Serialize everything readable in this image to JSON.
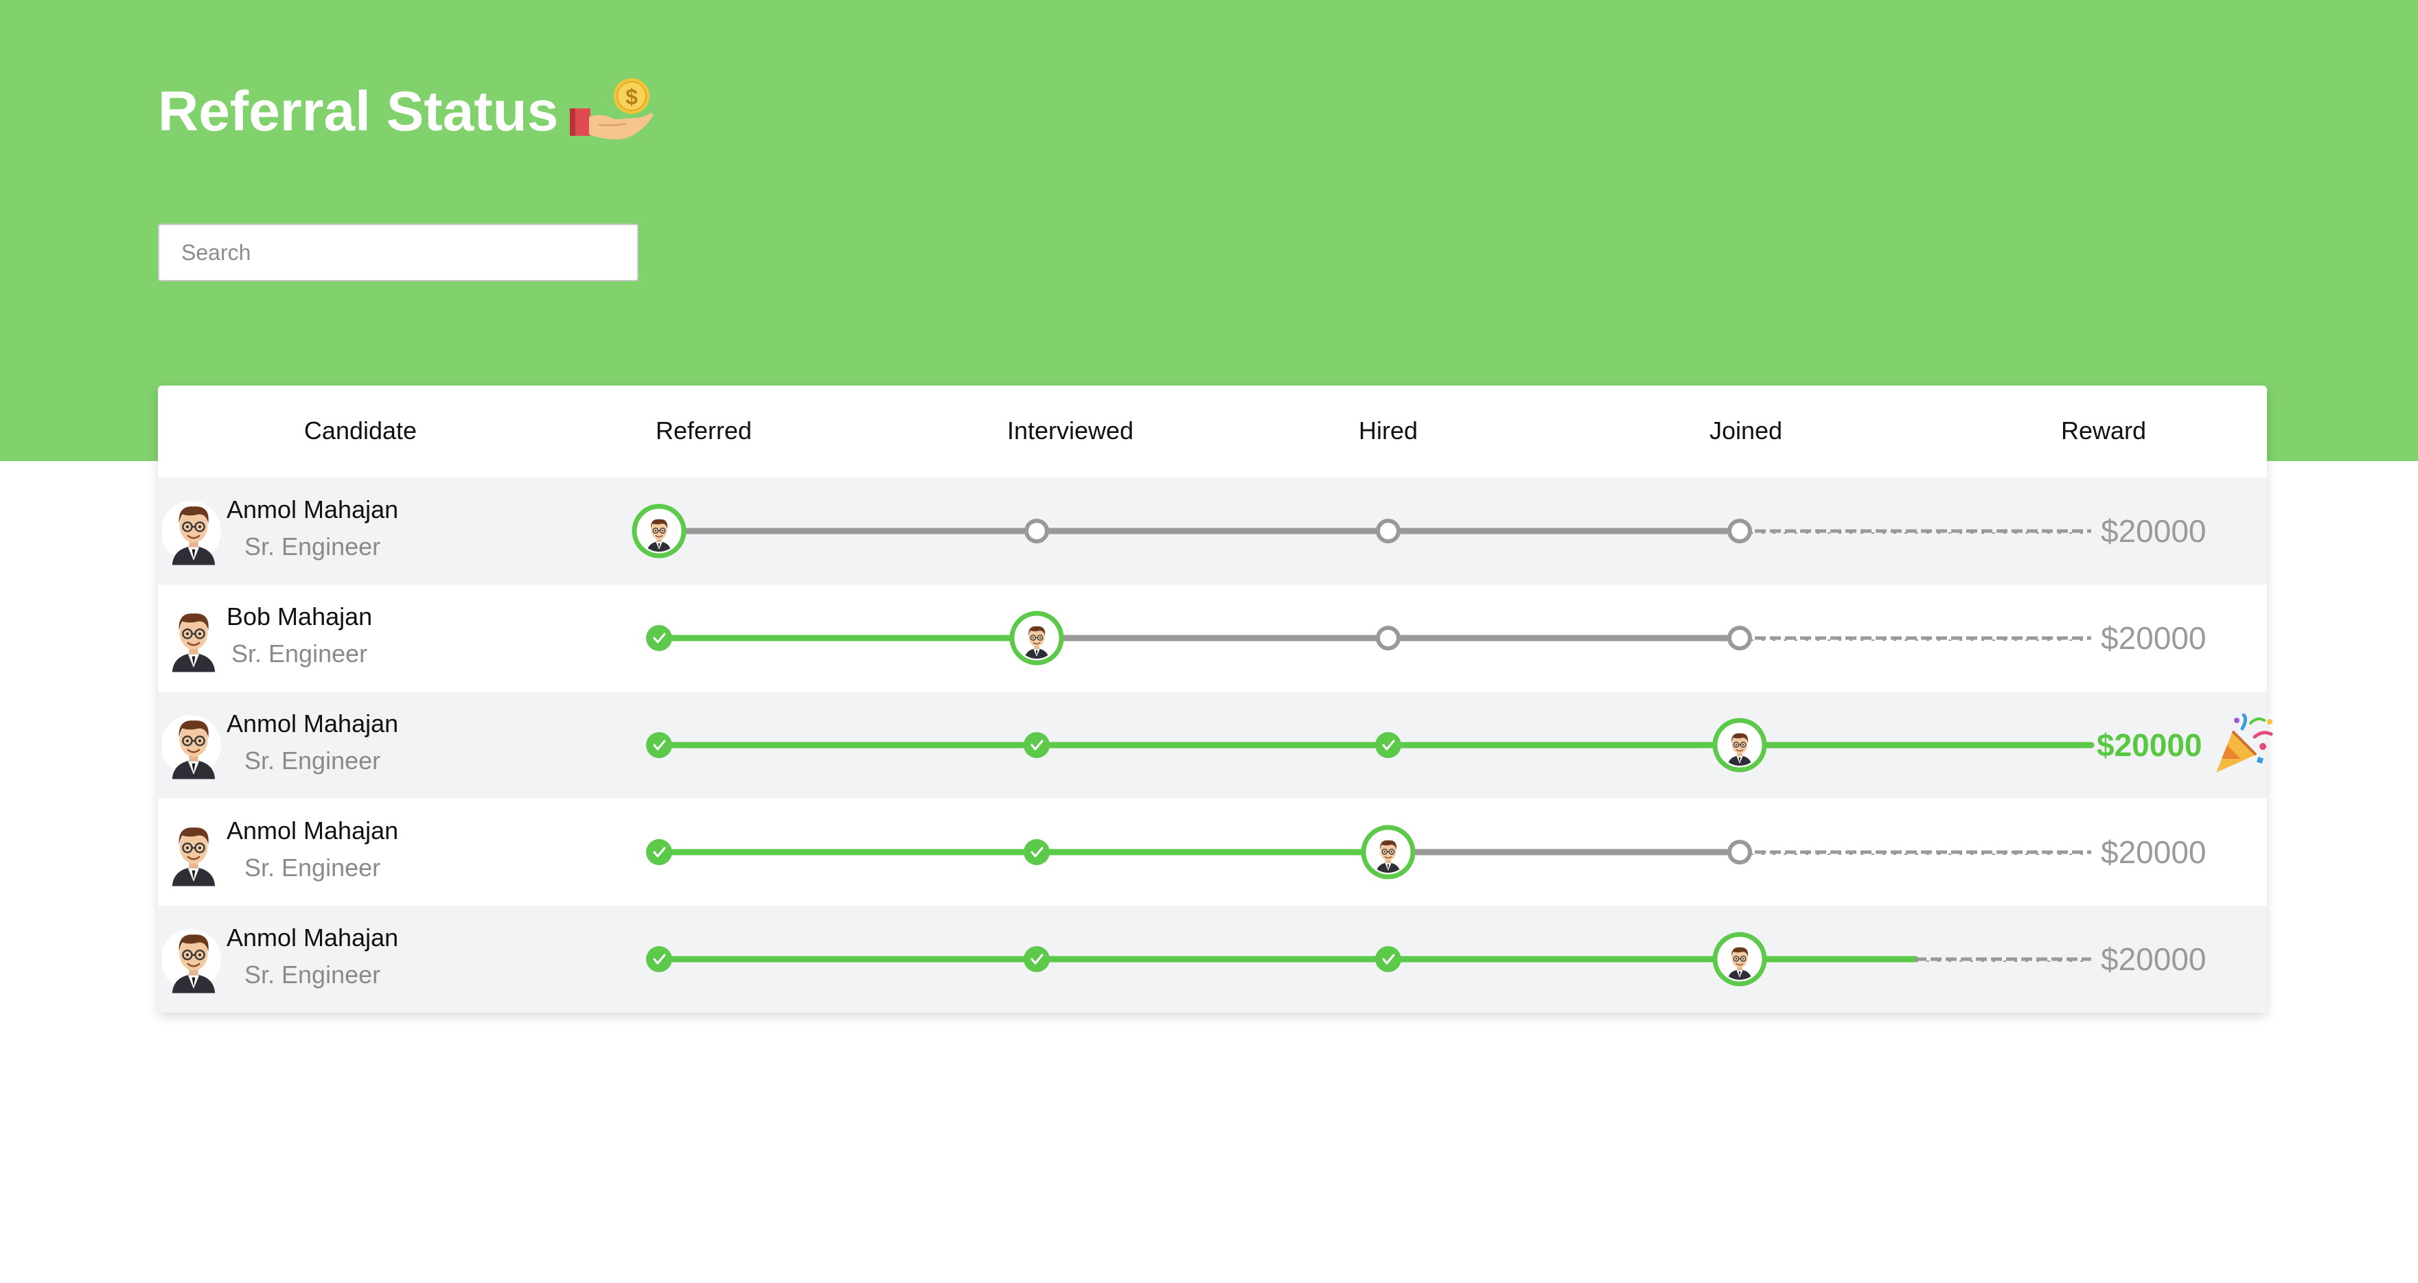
{
  "page": {
    "title": "Referral Status",
    "title_icon": "hand-coin-icon"
  },
  "search": {
    "placeholder": "Search",
    "value": ""
  },
  "colors": {
    "header_bg": "#81d16d",
    "complete_green": "#5cc94a",
    "pending_gray": "#999999",
    "row_shade": "#f2f3f5",
    "reward_won": "#58c843",
    "reward_pending": "#9a9a9a"
  },
  "table": {
    "columns": [
      "Candidate",
      "Referred",
      "Interviewed",
      "Hired",
      "Joined",
      "Reward"
    ],
    "stages": [
      "Referred",
      "Interviewed",
      "Hired",
      "Joined"
    ],
    "rows": [
      {
        "name": "Anmol Mahajan",
        "role": "Sr. Engineer",
        "current_stage": "Referred",
        "reward": "$20000",
        "reward_earned": false,
        "avatar_icon": "man-avatar-icon"
      },
      {
        "name": "Bob Mahajan",
        "role": "Sr. Engineer",
        "current_stage": "Interviewed",
        "reward": "$20000",
        "reward_earned": false,
        "avatar_icon": "man-avatar-icon"
      },
      {
        "name": "Anmol Mahajan",
        "role": "Sr. Engineer",
        "current_stage": "Joined",
        "reward": "$20000",
        "reward_earned": true,
        "reward_icon": "party-popper-icon",
        "avatar_icon": "man-avatar-icon"
      },
      {
        "name": "Anmol Mahajan",
        "role": "Sr. Engineer",
        "current_stage": "Hired",
        "reward": "$20000",
        "reward_earned": false,
        "avatar_icon": "man-avatar-icon"
      },
      {
        "name": "Anmol Mahajan",
        "role": "Sr. Engineer",
        "current_stage": "Joined",
        "reward": "$20000",
        "reward_earned": false,
        "reward_progress": 0.5,
        "avatar_icon": "man-avatar-icon"
      }
    ]
  }
}
